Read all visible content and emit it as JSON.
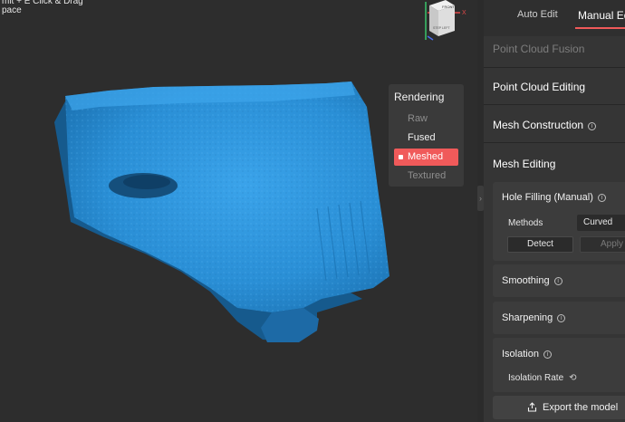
{
  "viewport": {
    "hint_line1": "mit + E Click & Drag",
    "hint_line2": "pace"
  },
  "axis_widget": {
    "face_top": "FRONT",
    "face_bottom": "STEP LEFT",
    "x_label": "X"
  },
  "rendering": {
    "title": "Rendering",
    "options": [
      "Raw",
      "Fused",
      "Meshed",
      "Textured"
    ],
    "selected": "Meshed"
  },
  "tabs": {
    "auto": "Auto Edit",
    "manual": "Manual Edit"
  },
  "sections": {
    "point_cloud_fusion": "Point Cloud Fusion",
    "point_cloud_editing": "Point Cloud Editing",
    "mesh_construction": "Mesh Construction",
    "mesh_editing": "Mesh Editing"
  },
  "hole_filling": {
    "title": "Hole Filling (Manual)",
    "methods_label": "Methods",
    "methods_value": "Curved",
    "detect": "Detect",
    "apply": "Apply"
  },
  "smoothing": {
    "title": "Smoothing"
  },
  "sharpening": {
    "title": "Sharpening"
  },
  "isolation": {
    "title": "Isolation",
    "rate_label": "Isolation Rate"
  },
  "export": {
    "label": "Export the model"
  },
  "colors": {
    "accent": "#f05a5a",
    "mesh": "#2a8fd6",
    "background": "#2d2d2d"
  }
}
